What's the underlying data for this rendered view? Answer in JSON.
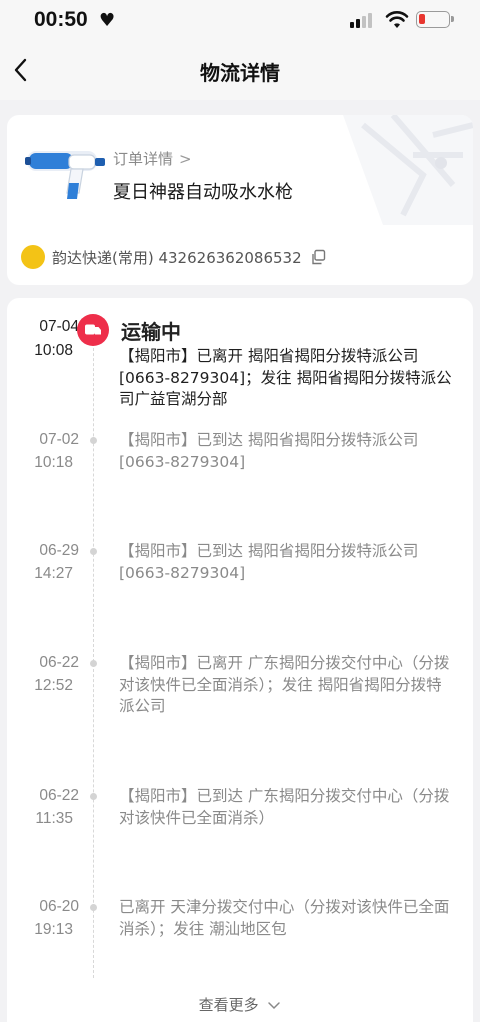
{
  "status_bar": {
    "time": "00:50",
    "heart_icon": "heart-icon",
    "signal_icon": "cellular-signal-icon",
    "wifi_icon": "wifi-icon",
    "battery_icon": "battery-low-icon",
    "battery_color": "#e8362f"
  },
  "nav": {
    "title": "物流详情",
    "back_icon": "chevron-left-icon"
  },
  "order": {
    "link_label": "订单详情",
    "link_chevron": ">",
    "product_name": "夏日神器自动吸水水枪",
    "courier_logo_text": "韵达",
    "courier_text": "韵达快递(常用) 432626362086532",
    "copy_icon": "copy-icon"
  },
  "timeline": {
    "accent_color": "#ee2e4a",
    "current_status": "运输中",
    "status_icon": "truck-icon",
    "entries": [
      {
        "date": "07-04",
        "time": "10:08",
        "desc": "【揭阳市】已离开 揭阳省揭阳分拨特派公司[0663-8279304]；发往 揭阳省揭阳分拨特派公司广益官湖分部"
      },
      {
        "date": "07-02",
        "time": "10:18",
        "desc": "【揭阳市】已到达 揭阳省揭阳分拨特派公司[0663-8279304]"
      },
      {
        "date": "06-29",
        "time": "14:27",
        "desc": "【揭阳市】已到达 揭阳省揭阳分拨特派公司[0663-8279304]"
      },
      {
        "date": "06-22",
        "time": "12:52",
        "desc": "【揭阳市】已离开 广东揭阳分拨交付中心（分拨对该快件已全面消杀）；发往 揭阳省揭阳分拨特派公司"
      },
      {
        "date": "06-22",
        "time": "11:35",
        "desc": "【揭阳市】已到达 广东揭阳分拨交付中心（分拨对该快件已全面消杀）"
      },
      {
        "date": "06-20",
        "time": "19:13",
        "desc": "已离开 天津分拨交付中心（分拨对该快件已全面消杀）；发往 潮汕地区包"
      }
    ],
    "more_label": "查看更多",
    "more_icon": "chevron-down-icon"
  }
}
